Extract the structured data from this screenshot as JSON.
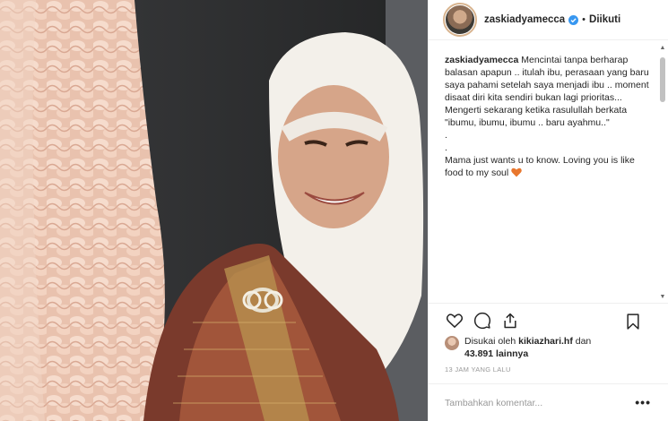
{
  "post": {
    "photo_alt": "photo",
    "image_text": "CHANEL"
  },
  "header": {
    "username": "zaskiadyamecca",
    "separator": "•",
    "follow_status": "Diikuti",
    "verified_icon": "verified-badge-icon"
  },
  "caption": {
    "username": "zaskiadyamecca",
    "text_line1": "Mencintai tanpa berharap balasan apapun .. itulah ibu, perasaan yang baru saya pahami setelah saya menjadi ibu .. moment disaat diri kita sendiri bukan lagi prioritas... Mengerti sekarang ketika rasulullah berkata \"ibumu, ibumu, ibumu .. baru ayahmu..\"",
    "dot1": ".",
    "dot2": ".",
    "text_line2": "Mama just wants u to know. Loving you is like food to my soul"
  },
  "actions": {
    "like_icon": "heart-outline-icon",
    "comment_icon": "comment-icon",
    "share_icon": "share-icon",
    "save_icon": "bookmark-icon"
  },
  "likes": {
    "prefix": "Disukai oleh",
    "user": "kikiazhari.hf",
    "connector": "dan",
    "count": "43.891",
    "suffix": "lainnya"
  },
  "timestamp": "13 JAM YANG LALU",
  "comment": {
    "placeholder": "Tambahkan komentar...",
    "more_label": "•••"
  },
  "colors": {
    "verified": "#3897f0",
    "heart_emoji": "#e8772e",
    "text": "#262626",
    "muted": "#999999"
  }
}
